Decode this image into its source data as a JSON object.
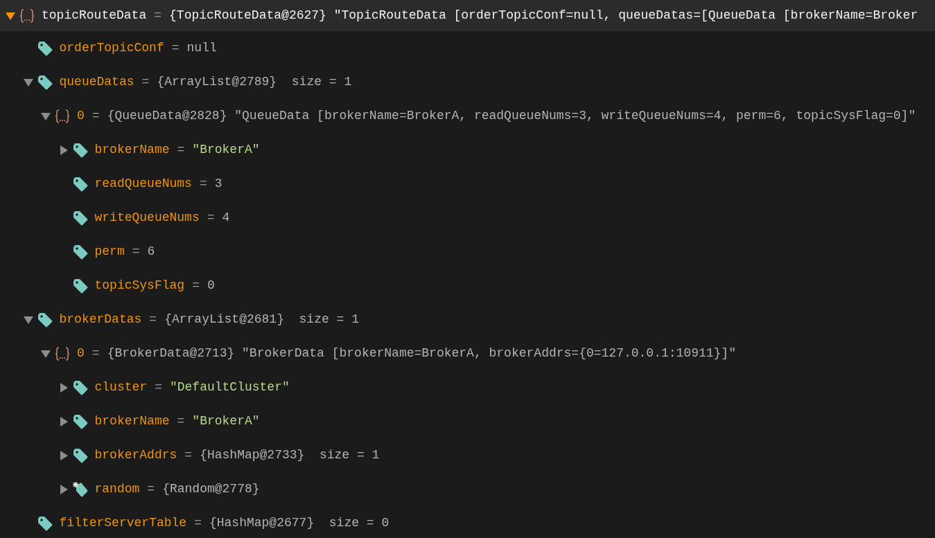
{
  "variables": [
    {
      "kind": "object",
      "name": "topicRouteData",
      "separator": "=",
      "value": "{TopicRouteData@2627} \"TopicRouteData [orderTopicConf=null, queueDatas=[QueueData [brokerName=Broker",
      "string_value": false,
      "selected": true,
      "expanded": true,
      "children": [
        {
          "kind": "field",
          "name": "orderTopicConf",
          "separator": "=",
          "value": "null",
          "string_value": false,
          "selected": false
        },
        {
          "kind": "field",
          "name": "queueDatas",
          "separator": "=",
          "value": "{ArrayList@2789}  size = 1",
          "string_value": false,
          "selected": false,
          "expanded": true,
          "children": [
            {
              "kind": "object",
              "name": "0",
              "separator": "=",
              "value": "{QueueData@2828} \"QueueData [brokerName=BrokerA, readQueueNums=3, writeQueueNums=4, perm=6, topicSysFlag=0]\"",
              "string_value": false,
              "selected": false,
              "expanded": true,
              "children": [
                {
                  "kind": "field",
                  "name": "brokerName",
                  "separator": "=",
                  "value": "\"BrokerA\"",
                  "string_value": true,
                  "selected": false,
                  "expanded": false
                },
                {
                  "kind": "field",
                  "name": "readQueueNums",
                  "separator": "=",
                  "value": "3",
                  "string_value": false,
                  "selected": false
                },
                {
                  "kind": "field",
                  "name": "writeQueueNums",
                  "separator": "=",
                  "value": "4",
                  "string_value": false,
                  "selected": false
                },
                {
                  "kind": "field",
                  "name": "perm",
                  "separator": "=",
                  "value": "6",
                  "string_value": false,
                  "selected": false
                },
                {
                  "kind": "field",
                  "name": "topicSysFlag",
                  "separator": "=",
                  "value": "0",
                  "string_value": false,
                  "selected": false
                }
              ]
            }
          ]
        },
        {
          "kind": "field",
          "name": "brokerDatas",
          "separator": "=",
          "value": "{ArrayList@2681}  size = 1",
          "string_value": false,
          "selected": false,
          "expanded": true,
          "children": [
            {
              "kind": "object",
              "name": "0",
              "separator": "=",
              "value": "{BrokerData@2713} \"BrokerData [brokerName=BrokerA, brokerAddrs={0=127.0.0.1:10911}]\"",
              "string_value": false,
              "selected": false,
              "expanded": true,
              "children": [
                {
                  "kind": "field",
                  "name": "cluster",
                  "separator": "=",
                  "value": "\"DefaultCluster\"",
                  "string_value": true,
                  "selected": false,
                  "expanded": false
                },
                {
                  "kind": "field",
                  "name": "brokerName",
                  "separator": "=",
                  "value": "\"BrokerA\"",
                  "string_value": true,
                  "selected": false,
                  "expanded": false
                },
                {
                  "kind": "field",
                  "name": "brokerAddrs",
                  "separator": "=",
                  "value": "{HashMap@2733}  size = 1",
                  "string_value": false,
                  "selected": false,
                  "expanded": false
                },
                {
                  "kind": "final-field",
                  "name": "random",
                  "separator": "=",
                  "value": "{Random@2778}",
                  "string_value": false,
                  "selected": false,
                  "expanded": false
                }
              ]
            }
          ]
        },
        {
          "kind": "field",
          "name": "filterServerTable",
          "separator": "=",
          "value": "{HashMap@2677}  size = 0",
          "string_value": false,
          "selected": false
        }
      ]
    }
  ]
}
